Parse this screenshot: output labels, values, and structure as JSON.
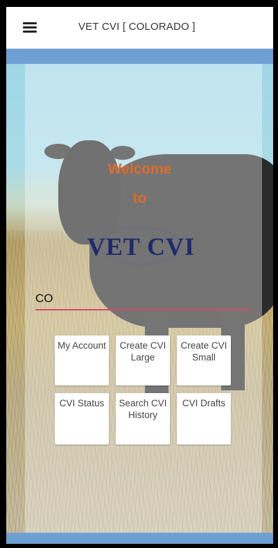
{
  "app_bar": {
    "title": "VET CVI [ COLORADO ]",
    "menu_icon": "menu-icon"
  },
  "welcome": {
    "line1": "Welcome",
    "line2": "to"
  },
  "logo": {
    "text": "VET CVI"
  },
  "state_input": {
    "value": "CO"
  },
  "tiles": [
    {
      "label": "My Account"
    },
    {
      "label": "Create CVI Large"
    },
    {
      "label": "Create CVI Small"
    },
    {
      "label": "CVI Status"
    },
    {
      "label": "Search CVI History"
    },
    {
      "label": "CVI Drafts"
    }
  ],
  "colors": {
    "accent_band": "#6fa0d3",
    "welcome_text": "#e06b2a",
    "logo_text": "#1f2a6b",
    "input_underline": "#d44a6a"
  }
}
